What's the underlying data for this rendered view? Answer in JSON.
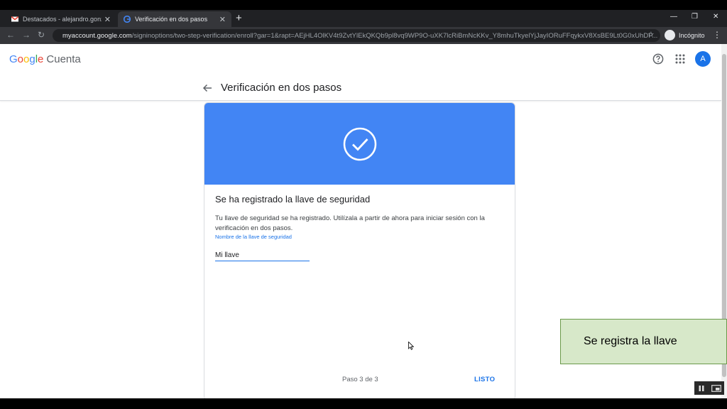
{
  "browser": {
    "tabs": [
      {
        "title": "Destacados - alejandro.gonzale",
        "icon": "gmail-icon",
        "active": false
      },
      {
        "title": "Verificación en dos pasos",
        "icon": "google-icon",
        "active": true
      }
    ],
    "url_host": "myaccount.google.com",
    "url_path": "/signinoptions/two-step-verification/enroll?gar=1&rapt=AEjHL4OlKV4t9ZvtYlEkQKQb9pl8vq9WP9O-uXK7lcRiBmNcKKv_Y8mhuTkyelYjJayIORuFFqykxV8XsBE9Lt0G0xUhDP...",
    "incognito_label": "Incógnito"
  },
  "header": {
    "logo_letters": [
      "G",
      "o",
      "o",
      "g",
      "l",
      "e"
    ],
    "product": "Cuenta",
    "avatar_letter": "A"
  },
  "subheader": {
    "title": "Verificación en dos pasos"
  },
  "card": {
    "banner_color": "#4285f4",
    "title": "Se ha registrado la llave de seguridad",
    "description": "Tu llave de seguridad se ha registrado. Utilízala a partir de ahora para iniciar sesión con la verificación en dos pasos.",
    "field_label": "Nombre de la llave de seguridad",
    "field_value": "Mi llave",
    "step": "Paso 3 de 3",
    "done_label": "LISTO"
  },
  "overlay": {
    "callout": "Se registra la llave"
  }
}
